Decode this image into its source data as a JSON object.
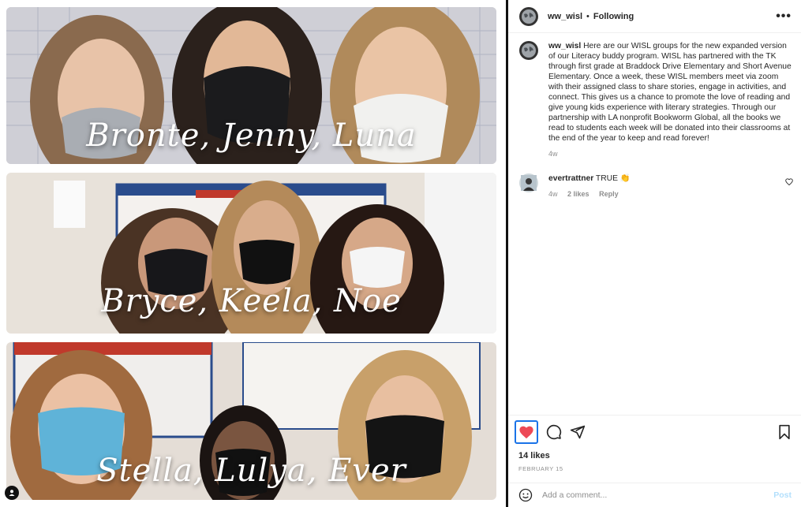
{
  "media": {
    "panels": [
      {
        "caption": "Bronte, Jenny, Luna"
      },
      {
        "caption": "Bryce, Keela, Noe"
      },
      {
        "caption": "Stella, Lulya, Ever"
      }
    ]
  },
  "header": {
    "username": "ww_wisl",
    "separator": "•",
    "follow_status": "Following",
    "more_label": "•••"
  },
  "caption": {
    "username": "ww_wisl",
    "text": "Here are our WISL groups for the new expanded version of our Literacy buddy program. WISL has partnered with the TK through first grade at Braddock Drive Elementary and Short Avenue Elementary. Once a week, these WISL members meet via zoom with their assigned class to share stories, engage in activities, and connect. This gives us a chance to promote the love of reading and give young kids experience with literary strategies. Through our partnership with LA nonprofit Bookworm Global, all the books we read to students each week will be donated into their classrooms at the end of the year to keep and read forever!",
    "age": "4w"
  },
  "comments": [
    {
      "username": "evertrattner",
      "text": "TRUE 👏",
      "age": "4w",
      "likes": "2 likes",
      "reply_label": "Reply"
    }
  ],
  "actions": {
    "likes": "14 likes",
    "date": "FEBRUARY 15",
    "liked": true
  },
  "add_comment": {
    "placeholder": "Add a comment...",
    "post_label": "Post"
  },
  "colors": {
    "like_red": "#ed4956",
    "focus_blue": "#1a73e8",
    "post_disabled": "#b2dffc"
  }
}
